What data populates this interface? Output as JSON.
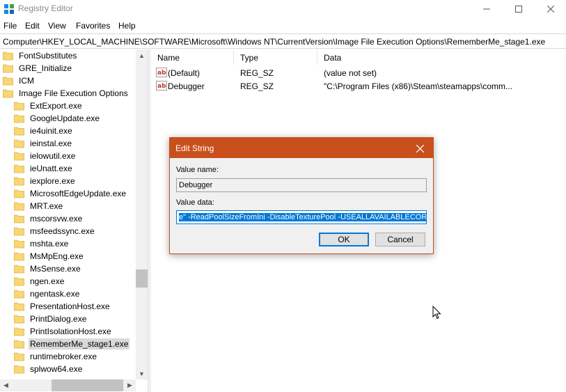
{
  "window": {
    "title": "Registry Editor",
    "minimize_label": "—",
    "maximize_label": "☐",
    "close_label": "✕"
  },
  "menu": {
    "items": [
      "File",
      "Edit",
      "View",
      "Favorites",
      "Help"
    ]
  },
  "address": {
    "path": "Computer\\HKEY_LOCAL_MACHINE\\SOFTWARE\\Microsoft\\Windows NT\\CurrentVersion\\Image File Execution Options\\RememberMe_stage1.exe"
  },
  "tree": {
    "items": [
      {
        "label": "FontSubstitutes",
        "level": 0
      },
      {
        "label": "GRE_Initialize",
        "level": 0
      },
      {
        "label": "ICM",
        "level": 0
      },
      {
        "label": "Image File Execution Options",
        "level": 0
      },
      {
        "label": "ExtExport.exe",
        "level": 1
      },
      {
        "label": "GoogleUpdate.exe",
        "level": 1
      },
      {
        "label": "ie4uinit.exe",
        "level": 1
      },
      {
        "label": "ieinstal.exe",
        "level": 1
      },
      {
        "label": "ielowutil.exe",
        "level": 1
      },
      {
        "label": "ieUnatt.exe",
        "level": 1
      },
      {
        "label": "iexplore.exe",
        "level": 1
      },
      {
        "label": "MicrosoftEdgeUpdate.exe",
        "level": 1
      },
      {
        "label": "MRT.exe",
        "level": 1
      },
      {
        "label": "mscorsvw.exe",
        "level": 1
      },
      {
        "label": "msfeedssync.exe",
        "level": 1
      },
      {
        "label": "mshta.exe",
        "level": 1
      },
      {
        "label": "MsMpEng.exe",
        "level": 1
      },
      {
        "label": "MsSense.exe",
        "level": 1
      },
      {
        "label": "ngen.exe",
        "level": 1
      },
      {
        "label": "ngentask.exe",
        "level": 1
      },
      {
        "label": "PresentationHost.exe",
        "level": 1
      },
      {
        "label": "PrintDialog.exe",
        "level": 1
      },
      {
        "label": "PrintIsolationHost.exe",
        "level": 1
      },
      {
        "label": "RememberMe_stage1.exe",
        "level": 1,
        "selected": true
      },
      {
        "label": "runtimebroker.exe",
        "level": 1
      },
      {
        "label": "splwow64.exe",
        "level": 1
      }
    ]
  },
  "list": {
    "columns": [
      "Name",
      "Type",
      "Data"
    ],
    "rows": [
      {
        "name": "(Default)",
        "type": "REG_SZ",
        "data": "(value not set)"
      },
      {
        "name": "Debugger",
        "type": "REG_SZ",
        "data": "\"C:\\Program Files (x86)\\Steam\\steamapps\\comm..."
      }
    ]
  },
  "dialog": {
    "title": "Edit String",
    "value_name_label": "Value name:",
    "value_name": "Debugger",
    "value_data_label": "Value data:",
    "value_data": "e\" -ReadPoolSizeFromIni -DisableTexturePool -USEALLAVAILABLECORES",
    "ok_label": "OK",
    "cancel_label": "Cancel"
  },
  "colors": {
    "dialog_title_bg": "#c9501c",
    "selection": "#0078d7",
    "folder": "#f8d775"
  }
}
